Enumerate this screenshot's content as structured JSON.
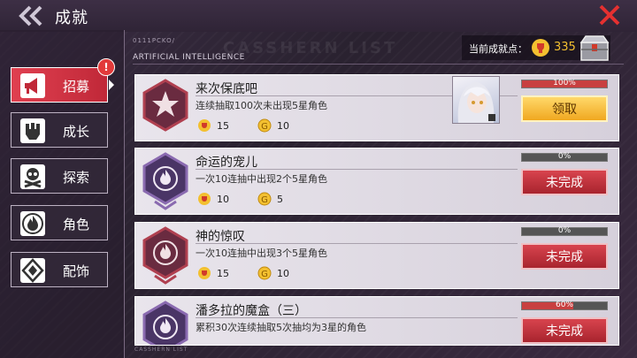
{
  "header": {
    "title": "成就"
  },
  "sidebar": {
    "items": [
      {
        "label": "招募",
        "icon": "megaphone-icon",
        "active": true
      },
      {
        "label": "成长",
        "icon": "fist-icon",
        "active": false
      },
      {
        "label": "探索",
        "icon": "skull-icon",
        "active": false
      },
      {
        "label": "角色",
        "icon": "flame-icon",
        "active": false
      },
      {
        "label": "配饰",
        "icon": "diamond-icon",
        "active": false
      }
    ],
    "badge": "!"
  },
  "section": {
    "code": "0111PCKO/",
    "subtitle": "ARTIFICIAL INTELLIGENCE",
    "watermark": "CASSHERN LIST",
    "footer": "CASSHERN LIST"
  },
  "points": {
    "label": "当前成就点：",
    "value": "335"
  },
  "achievements": [
    {
      "title": "来次保底吧",
      "desc": "连续抽取100次未出现5星角色",
      "reward_medal": "15",
      "reward_coin": "10",
      "progress": 100,
      "progress_text": "100%",
      "action": "领取",
      "state": "claim"
    },
    {
      "title": "命运的宠儿",
      "desc": "一次10连抽中出现2个5星角色",
      "reward_medal": "10",
      "reward_coin": "5",
      "progress": 0,
      "progress_text": "0%",
      "action": "未完成",
      "state": "todo"
    },
    {
      "title": "神的惊叹",
      "desc": "一次10连抽中出现3个5星角色",
      "reward_medal": "15",
      "reward_coin": "10",
      "progress": 0,
      "progress_text": "0%",
      "action": "未完成",
      "state": "todo"
    },
    {
      "title": "潘多拉的魔盒（三）",
      "desc": "累积30次连续抽取5次抽均为3星的角色",
      "progress": 60,
      "progress_text": "60%",
      "action": "未完成",
      "state": "todo"
    }
  ],
  "colors": {
    "accent_red": "#d8444e",
    "gold": "#f3c030"
  }
}
